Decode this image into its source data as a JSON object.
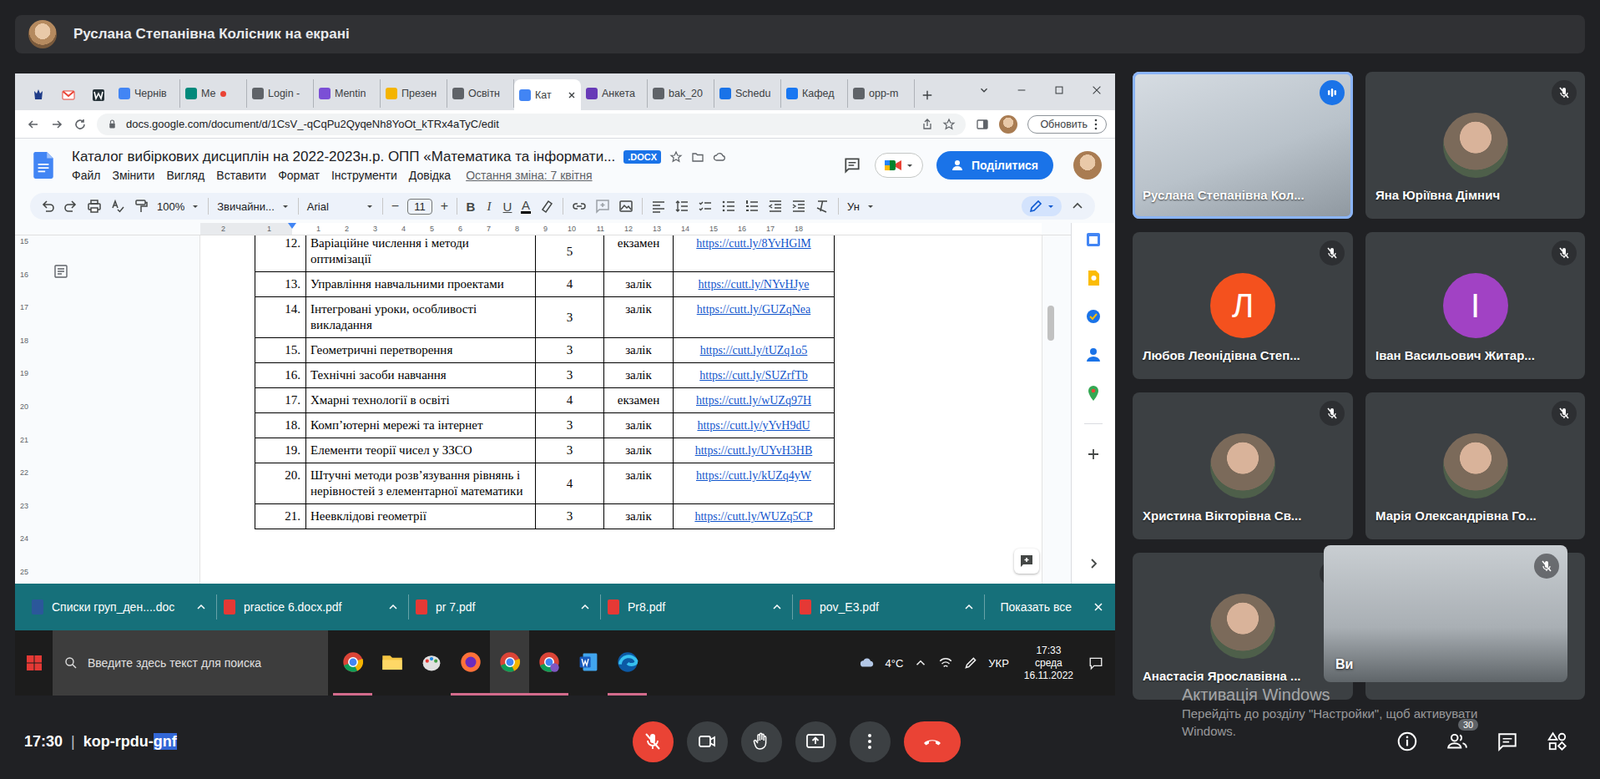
{
  "meet": {
    "presenter_banner": "Руслана Степанівна Колісник на екрані",
    "time": "17:30",
    "separator": "|",
    "meeting_code": "kop-rpdu-",
    "meeting_code_selected": "gnf",
    "participant_count": "30",
    "mic_muted": true
  },
  "browser": {
    "tabs": [
      {
        "label": "Чернів",
        "selected": false,
        "recording": false,
        "color": "#4285f4"
      },
      {
        "label": "Ме",
        "selected": false,
        "recording": true,
        "color": "#00897b"
      },
      {
        "label": "Login -",
        "selected": false,
        "recording": false,
        "color": "#5f6368"
      },
      {
        "label": "Mentin",
        "selected": false,
        "recording": false,
        "color": "#7b4fd6"
      },
      {
        "label": "Презен",
        "selected": false,
        "recording": false,
        "color": "#f4b400"
      },
      {
        "label": "Освітн",
        "selected": false,
        "recording": false,
        "color": "#5f6368"
      },
      {
        "label": "Кат",
        "selected": true,
        "recording": false,
        "color": "#4285f4"
      },
      {
        "label": "Анкета",
        "selected": false,
        "recording": false,
        "color": "#673ab7"
      },
      {
        "label": "bak_20",
        "selected": false,
        "recording": false,
        "color": "#5f6368"
      },
      {
        "label": "Schedu",
        "selected": false,
        "recording": false,
        "color": "#1a73e8"
      },
      {
        "label": "Кафед",
        "selected": false,
        "recording": false,
        "color": "#1877f2"
      },
      {
        "label": "орр-m",
        "selected": false,
        "recording": false,
        "color": "#5f6368"
      }
    ],
    "address": "docs.google.com/document/d/1CsV_-qCqPu2QyqeNh8YoOt_kTRx4aTyC/edit",
    "update_button": "Обновить"
  },
  "doc": {
    "title": "Каталог вибіркових дисциплін  на 2022-2023н.р.  ОПП «Математика та інформати...",
    "badge": ".DOCX",
    "menus": [
      "Файл",
      "Змінити",
      "Вигляд",
      "Вставити",
      "Формат",
      "Інструменти",
      "Довідка"
    ],
    "last_edit": "Остання зміна: 7 квітня",
    "share_button": "Поділитися",
    "toolbar": {
      "zoom": "100%",
      "style": "Звичайни...",
      "font": "Arial",
      "decrease": "−",
      "size": "11",
      "increase": "+",
      "format": [
        {
          "label": "B",
          "kind": "bold"
        },
        {
          "label": "I",
          "kind": "italic"
        },
        {
          "label": "U",
          "kind": "underline"
        },
        {
          "label": "A",
          "kind": "color"
        }
      ],
      "input_tools": "Ун"
    },
    "ruler": {
      "margin": [
        "2",
        "1"
      ],
      "content": [
        "1",
        "2",
        "3",
        "4",
        "5",
        "6",
        "7",
        "8",
        "9",
        "10",
        "11",
        "12",
        "13",
        "14",
        "15",
        "16",
        "17",
        "18"
      ]
    },
    "vertical_ruler": [
      "15",
      "16",
      "17",
      "18",
      "19",
      "20",
      "21",
      "22",
      "23",
      "24",
      "25"
    ],
    "table": {
      "rows": [
        {
          "num": "12.",
          "name": "Варіаційне числення і методи оптимізації",
          "credits": "5",
          "form": "екзамен",
          "link": "https://cutt.ly/8YvHGlM"
        },
        {
          "num": "13.",
          "name": "Управління навчальними проектами",
          "credits": "4",
          "form": "залік",
          "link": "https://cutt.ly/NYvHJye"
        },
        {
          "num": "14.",
          "name": "Інтегровані уроки, особливості викладання",
          "credits": "3",
          "form": "залік",
          "link": "https://cutt.ly/GUZqNea"
        },
        {
          "num": "15.",
          "name": "Геометричні перетворення",
          "credits": "3",
          "form": "залік",
          "link": "https://cutt.ly/tUZq1o5"
        },
        {
          "num": "16.",
          "name": "Технічні засоби навчання",
          "credits": "3",
          "form": "залік",
          "link": "https://cutt.ly/SUZrfTb"
        },
        {
          "num": "17.",
          "name": "Хмарні технології в освіті",
          "credits": "4",
          "form": "екзамен",
          "link": "https://cutt.ly/wUZq97H"
        },
        {
          "num": "18.",
          "name": "Комп’ютерні мережі та інтернет",
          "credits": "3",
          "form": "залік",
          "link": "https://cutt.ly/yYvH9dU"
        },
        {
          "num": "19.",
          "name": "Елементи теорії чисел у ЗЗСО",
          "credits": "3",
          "form": "залік",
          "link": "https://cutt.ly/UYvH3HB"
        },
        {
          "num": "20.",
          "name": "Штучні методи розв’язування рівнянь і нерівностей з елементарної математики",
          "credits": "4",
          "form": "залік",
          "link": "https://cutt.ly/kUZq4yW"
        },
        {
          "num": "21.",
          "name": "Неевклідові геометрії",
          "credits": "3",
          "form": "залік",
          "link": "https://cutt.ly/WUZq5CP"
        }
      ]
    }
  },
  "downloads": {
    "items": [
      {
        "name": "Списки груп_ден....doc",
        "kind": "doc"
      },
      {
        "name": "practice 6.docx.pdf",
        "kind": "pdf"
      },
      {
        "name": "pr 7.pdf",
        "kind": "pdf"
      },
      {
        "name": "Pr8.pdf",
        "kind": "pdf"
      },
      {
        "name": "pov_E3.pdf",
        "kind": "pdf"
      }
    ],
    "show_all": "Показать все"
  },
  "taskbar": {
    "search_placeholder": "Введите здесь текст для поиска",
    "weather": "4°C",
    "language": "УКР",
    "time": "17:33",
    "weekday": "среда",
    "date": "16.11.2022"
  },
  "participants": [
    {
      "name": "Руслана Степанівна Кол...",
      "kind": "video",
      "muted": false,
      "speaking": true
    },
    {
      "name": "Яна Юріївна Дімнич",
      "kind": "photo",
      "muted": true,
      "speaking": false
    },
    {
      "name": "Любов Леонідівна Степ...",
      "kind": "letter",
      "letter": "Л",
      "color": "#f4511e",
      "muted": true,
      "speaking": false
    },
    {
      "name": "Іван Васильович Житар...",
      "kind": "letter",
      "letter": "І",
      "color": "#a142c4",
      "muted": true,
      "speaking": false
    },
    {
      "name": "Христина Вікторівна Св...",
      "kind": "photo",
      "muted": true,
      "speaking": false
    },
    {
      "name": "Марія Олександрівна Го...",
      "kind": "photo",
      "muted": true,
      "speaking": false
    },
    {
      "name": "Анастасія Ярославівна ...",
      "kind": "photo",
      "muted": true,
      "speaking": false
    }
  ],
  "self_view": {
    "label": "Ви",
    "muted": true
  },
  "watermark": {
    "title": "Активація Windows",
    "text": "Перейдіть до розділу \"Настройки\", щоб активувати Windows."
  }
}
